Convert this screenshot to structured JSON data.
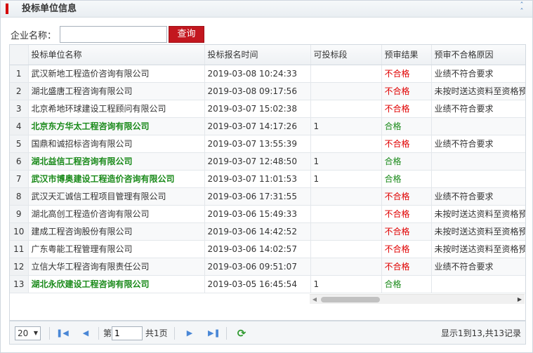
{
  "panel": {
    "title": "投标单位信息"
  },
  "search": {
    "label": "企业名称：",
    "value": "",
    "button": "查询"
  },
  "columns": [
    "投标单位名称",
    "投标报名时间",
    "可投标段",
    "预审结果",
    "预审不合格原因"
  ],
  "rows": [
    {
      "idx": "1",
      "name": "武汉新地工程造价咨询有限公司",
      "time": "2019-03-08 10:24:33",
      "section": "",
      "result": "不合格",
      "reason": "业绩不符合要求",
      "pass": false
    },
    {
      "idx": "2",
      "name": "湖北盛唐工程咨询有限公司",
      "time": "2019-03-08 09:17:56",
      "section": "",
      "result": "不合格",
      "reason": "未按时送达资料至资格预",
      "pass": false
    },
    {
      "idx": "3",
      "name": "北京希地环球建设工程顾问有限公司",
      "time": "2019-03-07 15:02:38",
      "section": "",
      "result": "不合格",
      "reason": "业绩不符合要求",
      "pass": false
    },
    {
      "idx": "4",
      "name": "北京东方华太工程咨询有限公司",
      "time": "2019-03-07 14:17:26",
      "section": "1",
      "result": "合格",
      "reason": "",
      "pass": true
    },
    {
      "idx": "5",
      "name": "国鼎和诚招标咨询有限公司",
      "time": "2019-03-07 13:55:39",
      "section": "",
      "result": "不合格",
      "reason": "业绩不符合要求",
      "pass": false
    },
    {
      "idx": "6",
      "name": "湖北益信工程咨询有限公司",
      "time": "2019-03-07 12:48:50",
      "section": "1",
      "result": "合格",
      "reason": "",
      "pass": true
    },
    {
      "idx": "7",
      "name": "武汉市博奥建设工程造价咨询有限公司",
      "time": "2019-03-07 11:01:53",
      "section": "1",
      "result": "合格",
      "reason": "",
      "pass": true
    },
    {
      "idx": "8",
      "name": "武汉天汇诚信工程项目管理有限公司",
      "time": "2019-03-06 17:31:55",
      "section": "",
      "result": "不合格",
      "reason": "业绩不符合要求",
      "pass": false
    },
    {
      "idx": "9",
      "name": "湖北高创工程造价咨询有限公司",
      "time": "2019-03-06 15:49:33",
      "section": "",
      "result": "不合格",
      "reason": "未按时送达资料至资格预",
      "pass": false
    },
    {
      "idx": "10",
      "name": "建成工程咨询股份有限公司",
      "time": "2019-03-06 14:42:52",
      "section": "",
      "result": "不合格",
      "reason": "未按时送达资料至资格预",
      "pass": false
    },
    {
      "idx": "11",
      "name": "广东粤能工程管理有限公司",
      "time": "2019-03-06 14:02:57",
      "section": "",
      "result": "不合格",
      "reason": "未按时送达资料至资格预",
      "pass": false
    },
    {
      "idx": "12",
      "name": "立信大华工程咨询有限责任公司",
      "time": "2019-03-06 09:51:07",
      "section": "",
      "result": "不合格",
      "reason": "业绩不符合要求",
      "pass": false
    },
    {
      "idx": "13",
      "name": "湖北永欣建设工程咨询有限公司",
      "time": "2019-03-05 16:45:54",
      "section": "1",
      "result": "合格",
      "reason": "",
      "pass": true
    }
  ],
  "pager": {
    "page_size": "20",
    "page_prefix": "第",
    "page_value": "1",
    "page_suffix": "共1页",
    "info": "显示1到13,共13记录"
  },
  "colors": {
    "accent_red": "#c3171f",
    "pass_green": "#1a8a1a",
    "fail_red": "#e00000"
  }
}
